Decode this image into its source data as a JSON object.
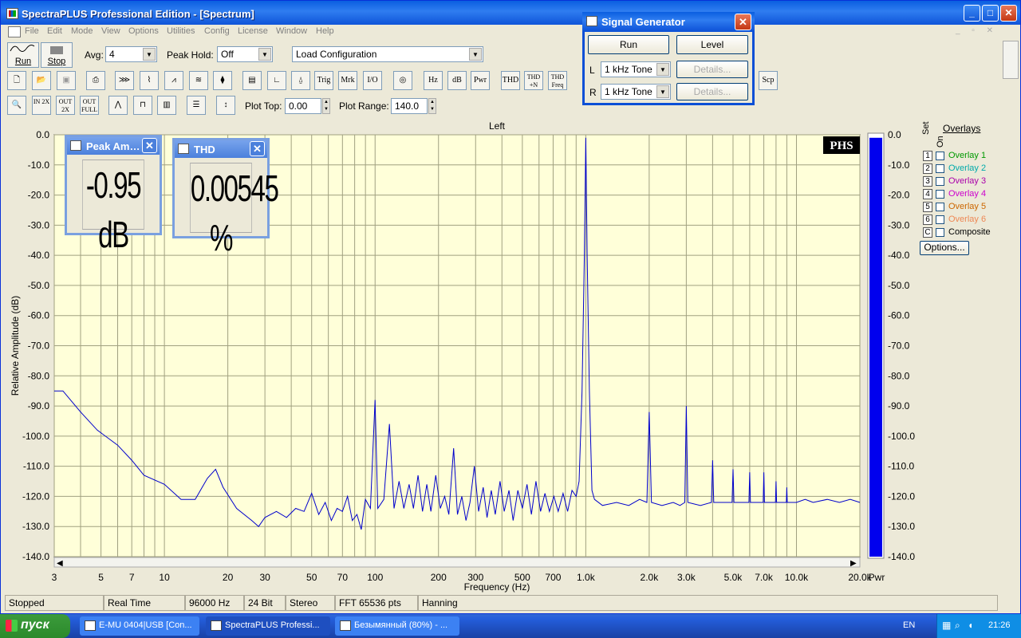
{
  "window": {
    "title": "SpectraPLUS Professional Edition - [Spectrum]",
    "min": "_",
    "max": "□",
    "close": "✕"
  },
  "menu": [
    "File",
    "Edit",
    "Mode",
    "View",
    "Options",
    "Utilities",
    "Config",
    "License",
    "Window",
    "Help"
  ],
  "toolbar1": {
    "run": "Run",
    "stop": "Stop",
    "avg_label": "Avg:",
    "avg_value": "4",
    "peak_hold_label": "Peak Hold:",
    "peak_hold_value": "Off",
    "load_config": "Load Configuration"
  },
  "toolbar2": {
    "trig": "Trig",
    "mrk": "Mrk",
    "io": "I/O",
    "hz": "Hz",
    "db": "dB",
    "pwr": "Pwr",
    "thd": "THD",
    "thdn": "THD +N",
    "thd_freq": "THD Freq",
    "scp": "Scp"
  },
  "toolbar3": {
    "zin": "IN 2X",
    "zout": "OUT 2X",
    "zfull": "OUT FULL",
    "plot_top_label": "Plot Top:",
    "plot_top_value": "0.00",
    "plot_range_label": "Plot Range:",
    "plot_range_value": "140.0"
  },
  "plot": {
    "channel_title": "Left",
    "badge": "PHS",
    "bar_label": "Pwr"
  },
  "overlays": {
    "title": "Overlays",
    "col_set": "Set",
    "col_on": "On",
    "items": [
      {
        "num": "1",
        "label": "Overlay 1",
        "color": "#009900"
      },
      {
        "num": "2",
        "label": "Overlay 2",
        "color": "#00aaaa"
      },
      {
        "num": "3",
        "label": "Overlay 3",
        "color": "#aa00aa"
      },
      {
        "num": "4",
        "label": "Overlay 4",
        "color": "#cc00cc"
      },
      {
        "num": "5",
        "label": "Overlay 5",
        "color": "#cc6600"
      },
      {
        "num": "6",
        "label": "Overlay 6",
        "color": "#ee8855"
      },
      {
        "num": "C",
        "label": "Composite",
        "color": "#000000"
      }
    ],
    "options_button": "Options..."
  },
  "peak_meter": {
    "title": "Peak Am…",
    "value": "-0.95 dB"
  },
  "thd_meter": {
    "title": "THD",
    "value": "0.00545 %"
  },
  "signal_generator": {
    "title": "Signal Generator",
    "run": "Run",
    "level": "Level",
    "left_label": "L",
    "left_value": "1 kHz Tone",
    "right_label": "R",
    "right_value": "1 kHz Tone",
    "details": "Details..."
  },
  "status": [
    "Stopped",
    "Real Time",
    "96000 Hz",
    "24 Bit",
    "Stereo",
    "FFT 65536 pts",
    "Hanning"
  ],
  "taskbar": {
    "start": "пуск",
    "tasks": [
      "E-MU 0404|USB [Con...",
      "SpectraPLUS Professi...",
      "Безымянный (80%) - ..."
    ],
    "lang": "EN",
    "time": "21:26"
  },
  "chart_data": {
    "type": "line",
    "title": "Left",
    "xlabel": "Frequency (Hz)",
    "ylabel": "Relative Amplitude (dB)",
    "x_scale": "log",
    "xlim": [
      3,
      20000
    ],
    "ylim": [
      -140,
      0
    ],
    "x_ticks": [
      {
        "v": 3,
        "l": "3"
      },
      {
        "v": 5,
        "l": "5"
      },
      {
        "v": 7,
        "l": "7"
      },
      {
        "v": 10,
        "l": "10"
      },
      {
        "v": 20,
        "l": "20"
      },
      {
        "v": 30,
        "l": "30"
      },
      {
        "v": 50,
        "l": "50"
      },
      {
        "v": 70,
        "l": "70"
      },
      {
        "v": 100,
        "l": "100"
      },
      {
        "v": 200,
        "l": "200"
      },
      {
        "v": 300,
        "l": "300"
      },
      {
        "v": 500,
        "l": "500"
      },
      {
        "v": 700,
        "l": "700"
      },
      {
        "v": 1000,
        "l": "1.0k"
      },
      {
        "v": 2000,
        "l": "2.0k"
      },
      {
        "v": 3000,
        "l": "3.0k"
      },
      {
        "v": 5000,
        "l": "5.0k"
      },
      {
        "v": 7000,
        "l": "7.0k"
      },
      {
        "v": 10000,
        "l": "10.0k"
      },
      {
        "v": 20000,
        "l": "20.0k"
      }
    ],
    "y_ticks": [
      "0.0",
      "-10.0",
      "-20.0",
      "-30.0",
      "-40.0",
      "-50.0",
      "-60.0",
      "-70.0",
      "-80.0",
      "-90.0",
      "-100.0",
      "-110.0",
      "-120.0",
      "-130.0",
      "-140.0"
    ],
    "grid": true,
    "series": [
      {
        "color": "#0000cc",
        "points": [
          [
            3,
            -85
          ],
          [
            3.3,
            -85
          ],
          [
            4,
            -92
          ],
          [
            4.8,
            -98
          ],
          [
            6,
            -103
          ],
          [
            7,
            -108
          ],
          [
            8,
            -113
          ],
          [
            10,
            -116
          ],
          [
            12,
            -121
          ],
          [
            14,
            -121
          ],
          [
            16,
            -114
          ],
          [
            17.5,
            -111
          ],
          [
            19,
            -117
          ],
          [
            22,
            -124
          ],
          [
            26,
            -128
          ],
          [
            28,
            -130
          ],
          [
            30,
            -127
          ],
          [
            34,
            -125
          ],
          [
            38,
            -127
          ],
          [
            42,
            -124
          ],
          [
            46,
            -125
          ],
          [
            50,
            -119
          ],
          [
            54,
            -126
          ],
          [
            58,
            -122
          ],
          [
            62,
            -128
          ],
          [
            66,
            -124
          ],
          [
            70,
            -125
          ],
          [
            74,
            -120
          ],
          [
            78,
            -128
          ],
          [
            82,
            -126
          ],
          [
            86,
            -131
          ],
          [
            90,
            -121
          ],
          [
            95,
            -124
          ],
          [
            100,
            -88
          ],
          [
            103,
            -124
          ],
          [
            110,
            -121
          ],
          [
            117,
            -96
          ],
          [
            123,
            -124
          ],
          [
            130,
            -115
          ],
          [
            137,
            -124
          ],
          [
            145,
            -116
          ],
          [
            152,
            -124
          ],
          [
            160,
            -113
          ],
          [
            168,
            -125
          ],
          [
            176,
            -116
          ],
          [
            184,
            -125
          ],
          [
            194,
            -113
          ],
          [
            204,
            -124
          ],
          [
            214,
            -120
          ],
          [
            224,
            -126
          ],
          [
            236,
            -104
          ],
          [
            246,
            -126
          ],
          [
            258,
            -120
          ],
          [
            270,
            -128
          ],
          [
            282,
            -122
          ],
          [
            296,
            -110
          ],
          [
            310,
            -125
          ],
          [
            326,
            -117
          ],
          [
            340,
            -127
          ],
          [
            356,
            -118
          ],
          [
            372,
            -126
          ],
          [
            392,
            -115
          ],
          [
            410,
            -125
          ],
          [
            432,
            -118
          ],
          [
            452,
            -128
          ],
          [
            476,
            -118
          ],
          [
            500,
            -124
          ],
          [
            526,
            -116
          ],
          [
            552,
            -126
          ],
          [
            580,
            -115
          ],
          [
            610,
            -125
          ],
          [
            640,
            -119
          ],
          [
            672,
            -125
          ],
          [
            706,
            -120
          ],
          [
            740,
            -125
          ],
          [
            780,
            -119
          ],
          [
            820,
            -125
          ],
          [
            860,
            -118
          ],
          [
            900,
            -120
          ],
          [
            930,
            -115
          ],
          [
            960,
            -85
          ],
          [
            985,
            -40
          ],
          [
            1000,
            -1
          ],
          [
            1015,
            -40
          ],
          [
            1040,
            -85
          ],
          [
            1070,
            -118
          ],
          [
            1100,
            -121
          ],
          [
            1200,
            -123
          ],
          [
            1400,
            -122
          ],
          [
            1600,
            -123
          ],
          [
            1800,
            -121
          ],
          [
            1950,
            -122
          ],
          [
            2000,
            -92
          ],
          [
            2050,
            -122
          ],
          [
            2300,
            -123
          ],
          [
            2600,
            -122
          ],
          [
            2800,
            -123
          ],
          [
            2950,
            -122
          ],
          [
            3000,
            -90
          ],
          [
            3050,
            -122
          ],
          [
            3500,
            -123
          ],
          [
            3950,
            -122
          ],
          [
            4000,
            -108
          ],
          [
            4050,
            -122
          ],
          [
            4950,
            -122
          ],
          [
            5000,
            -111
          ],
          [
            5050,
            -122
          ],
          [
            5950,
            -122
          ],
          [
            6000,
            -112
          ],
          [
            6050,
            -122
          ],
          [
            6950,
            -122
          ],
          [
            7000,
            -112
          ],
          [
            7050,
            -122
          ],
          [
            7950,
            -122
          ],
          [
            8000,
            -115
          ],
          [
            8050,
            -122
          ],
          [
            8950,
            -122
          ],
          [
            9000,
            -117
          ],
          [
            9050,
            -122
          ],
          [
            10000,
            -122
          ],
          [
            11000,
            -121
          ],
          [
            12000,
            -122
          ],
          [
            14000,
            -121
          ],
          [
            16000,
            -122
          ],
          [
            18000,
            -121
          ],
          [
            20000,
            -122
          ]
        ]
      }
    ],
    "power_bar": {
      "color": "#0000ee",
      "value_db": -1
    }
  }
}
